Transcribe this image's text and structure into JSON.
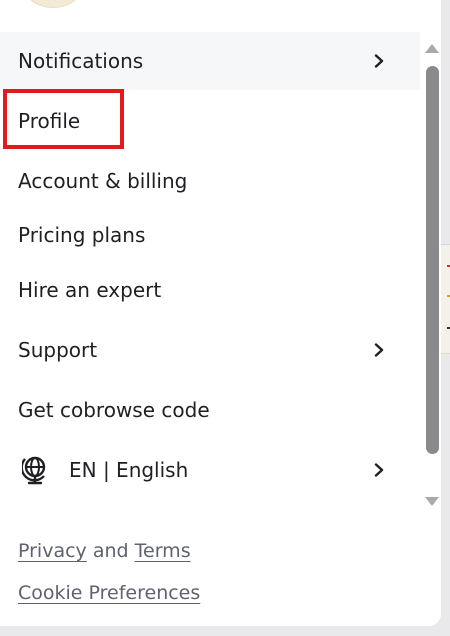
{
  "menu": {
    "notifications": "Notifications",
    "profile": "Profile",
    "account_billing": "Account & billing",
    "pricing_plans": "Pricing plans",
    "hire_expert": "Hire an expert",
    "support": "Support",
    "cobrowse": "Get cobrowse code",
    "language": "EN | English"
  },
  "footer": {
    "privacy": "Privacy",
    "and": "and",
    "terms": "Terms",
    "cookie_preferences": "Cookie Preferences"
  },
  "colors": {
    "highlight": "#e01b1b",
    "scroll_thumb": "#8a8a8d"
  },
  "icons": {
    "chevron": "chevron-right-icon",
    "globe": "globe-icon"
  }
}
